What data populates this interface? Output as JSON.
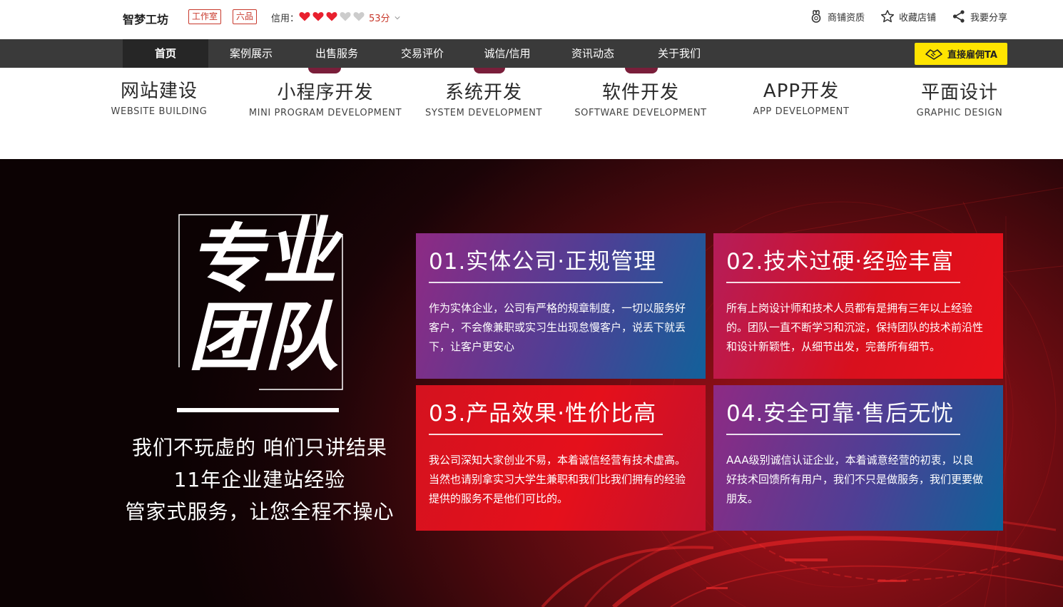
{
  "topbar": {
    "shop_name": "智梦工坊",
    "tags": [
      "工作室",
      "六品"
    ],
    "credit_label": "信用：",
    "credit_hearts": {
      "filled": 3,
      "total": 5
    },
    "credit_score": "53分",
    "actions": [
      {
        "label": "商铺资质",
        "icon": "medal-icon"
      },
      {
        "label": "收藏店铺",
        "icon": "star-icon"
      },
      {
        "label": "我要分享",
        "icon": "share-icon"
      }
    ]
  },
  "nav": {
    "items": [
      "首页",
      "案例展示",
      "出售服务",
      "交易评价",
      "诚信/信用",
      "资讯动态",
      "关于我们"
    ],
    "active_index": 0,
    "hire_button": "直接雇佣TA",
    "hire_icon": "handshake-icon"
  },
  "services": [
    {
      "title": "网站建设",
      "subtitle": "WEBSITE BUILDING"
    },
    {
      "title": "小程序开发",
      "subtitle": "MINI PROGRAM DEVELOPMENT"
    },
    {
      "title": "系统开发",
      "subtitle": "SYSTEM DEVELOPMENT"
    },
    {
      "title": "软件开发",
      "subtitle": "SOFTWARE DEVELOPMENT"
    },
    {
      "title": "APP开发",
      "subtitle": "APP DEVELOPMENT"
    },
    {
      "title": "平面设计",
      "subtitle": "GRAPHIC DESIGN"
    }
  ],
  "hero": {
    "big_chars": [
      "专",
      "业",
      "团",
      "队"
    ],
    "slogan": [
      "我们不玩虚的 咱们只讲结果",
      "11年企业建站经验",
      "管家式服务，让您全程不操心"
    ],
    "cards": [
      {
        "title": "01.实体公司·正规管理",
        "body": "作为实体企业，公司有严格的规章制度，一切以服务好客户，不会像兼职或实习生出现怠慢客户，说丢下就丢下，让客户更安心"
      },
      {
        "title": "02.技术过硬·经验丰富",
        "body": "所有上岗设计师和技术人员都有是拥有三年以上经验的。团队一直不断学习和沉淀，保持团队的技术前沿性和设计新颖性，从细节出发，完善所有细节。"
      },
      {
        "title": "03.产品效果·性价比高",
        "body": "我公司深知大家创业不易，本着诚信经营有技术虚高。当然也请别拿实习大学生兼职和我们比我们拥有的经验提供的服务不是他们可比的。"
      },
      {
        "title": "04.安全可靠·售后无忧",
        "body": "AAA级别诚信认证企业，本着诚意经营的初衷，以良好技术回馈所有用户，我们不只是做服务，我们更要做朋友。"
      }
    ]
  },
  "colors": {
    "nav_bg": "#3a3a3a",
    "nav_active_bg": "#262626",
    "hire_button_bg": "#ffe400",
    "tag_red": "#c8382b",
    "heart_filled": "#e8202e",
    "heart_empty": "#cccccc"
  }
}
